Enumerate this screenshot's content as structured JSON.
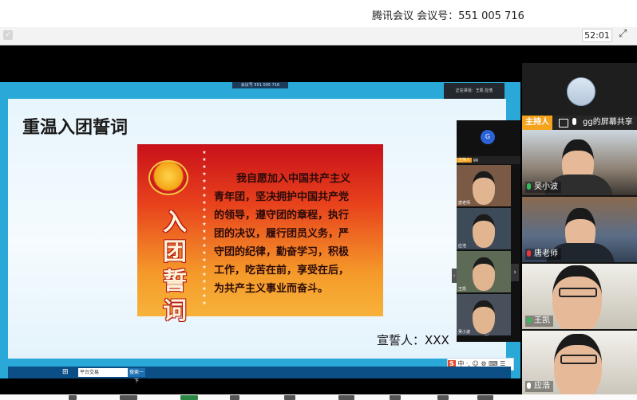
{
  "window": {
    "title": "腾讯会议 会议号：551 005 716",
    "timer": "52:01"
  },
  "share": {
    "banner": "会议号 551 005 716",
    "status": "正在讲话：王凯 应浩"
  },
  "slide": {
    "title": "重温入团誓词",
    "poster_vertical": [
      "入",
      "团",
      "誓",
      "词"
    ],
    "oath_lines": [
      "我自愿加入中国共产主义",
      "青年团，坚决拥护中国共产党",
      "的领导，遵守团的章程，执行",
      "团的决议，履行团员义务，严",
      "守团的纪律，勤奋学习，积极",
      "工作，吃苦在前，享受在后，",
      "为共产主义事业而奋斗。"
    ],
    "swearer": "宣誓人：XXX"
  },
  "shared_desktop": {
    "ime_text": "中 ·, ☺ ⚙ ⌨ ☰",
    "ime_logo": "S",
    "search_text": "平台交易",
    "search_button": "搜索一下"
  },
  "inner_panel": {
    "avatar_letter": "G",
    "host_tag": "主持人",
    "host_name": "gg",
    "tiles": [
      {
        "name": "唐老师"
      },
      {
        "name": "应浩"
      },
      {
        "name": "王凯"
      },
      {
        "name": "吴小波"
      }
    ]
  },
  "panel": {
    "host_tag": "主持人",
    "host_name": "gg的屏幕共享",
    "participants": [
      {
        "name": "吴小波",
        "mic": "on"
      },
      {
        "name": "唐老师",
        "mic": "off"
      },
      {
        "name": "王凯",
        "mic": "on"
      },
      {
        "name": "应浩",
        "mic": "white"
      }
    ]
  },
  "colors": {
    "host_tag": "#f5a21c",
    "share_border": "#2aa9d9",
    "mic_on": "#2ebd59",
    "mic_off": "#ee3333"
  }
}
